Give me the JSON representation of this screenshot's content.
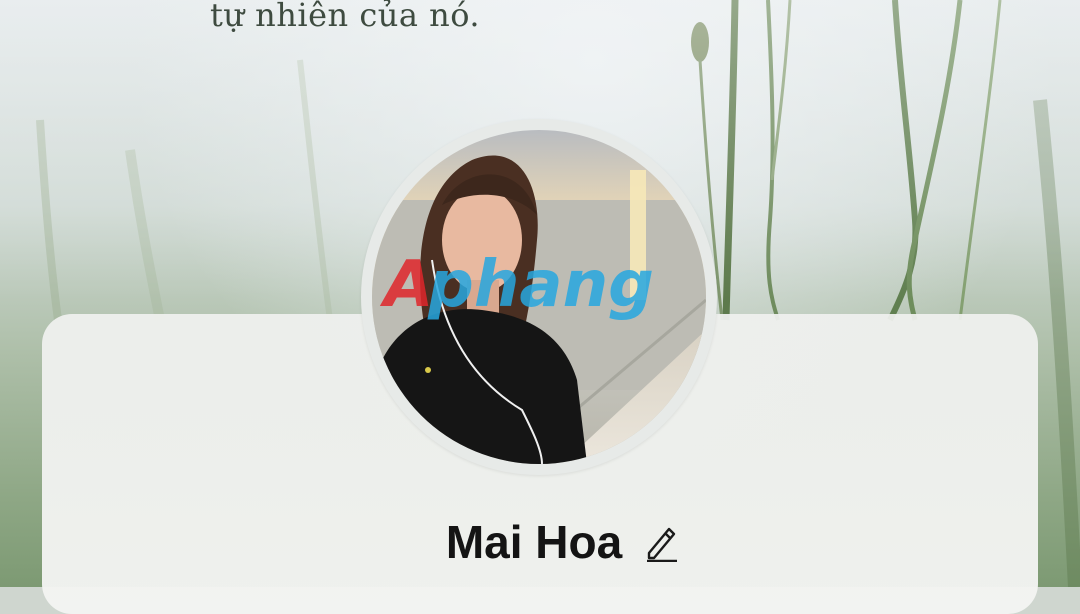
{
  "cover": {
    "caption": "tự nhiên của nó."
  },
  "avatar": {
    "watermark_text": "Aphang"
  },
  "profile": {
    "name": "Mai Hoa",
    "edit_icon": "pencil-icon"
  },
  "colors": {
    "name_text": "#141414",
    "card_background": "#f1f2f0",
    "watermark_red": "#e0262b",
    "watermark_blue": "#27a7e0"
  }
}
